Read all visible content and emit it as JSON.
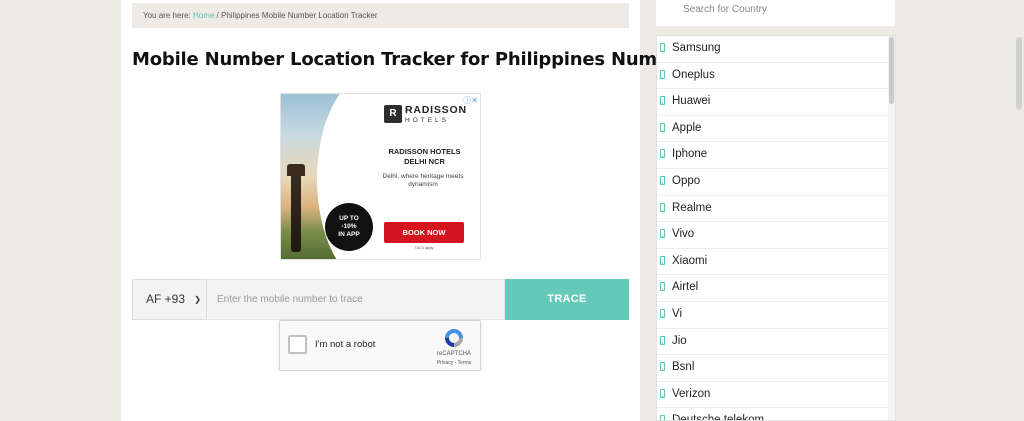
{
  "breadcrumb": {
    "prefix": "You are here: ",
    "home": "Home",
    "separator": " / ",
    "current": "Philippines Mobile Number Location Tracker"
  },
  "page": {
    "title": "Mobile Number Location Tracker for Philippines Number"
  },
  "ad": {
    "logo_mark": "R",
    "brand": "RADISSON",
    "brand_sub": "HOTELS",
    "title_line1": "RADISSON HOTELS",
    "title_line2": "DELHI NCR",
    "description": "Delhi, where heritage meets dynamism",
    "badge_line1": "UP TO",
    "badge_line2": "-10%",
    "badge_line3": "IN APP",
    "cta": "BOOK NOW",
    "fine_print": "T&C's apply",
    "adchoices_icon": "adchoices-icon",
    "cta_color": "#d6141f"
  },
  "form": {
    "country_code": "AF +93",
    "placeholder": "Enter the mobile number to trace",
    "button": "TRACE",
    "accent_color": "#64c9b8"
  },
  "recaptcha": {
    "label": "I'm not a robot",
    "brand": "reCAPTCHA",
    "links": "Privacy - Terms"
  },
  "sidebar": {
    "search_placeholder": "Search for Country",
    "brands": [
      "Samsung",
      "Oneplus",
      "Huawei",
      "Apple",
      "Iphone",
      "Oppo",
      "Realme",
      "Vivo",
      "Xiaomi",
      "Airtel",
      "Vi",
      "Jio",
      "Bsnl",
      "Verizon",
      "Deutsche telekom"
    ],
    "icon": "mobile-phone-icon"
  }
}
